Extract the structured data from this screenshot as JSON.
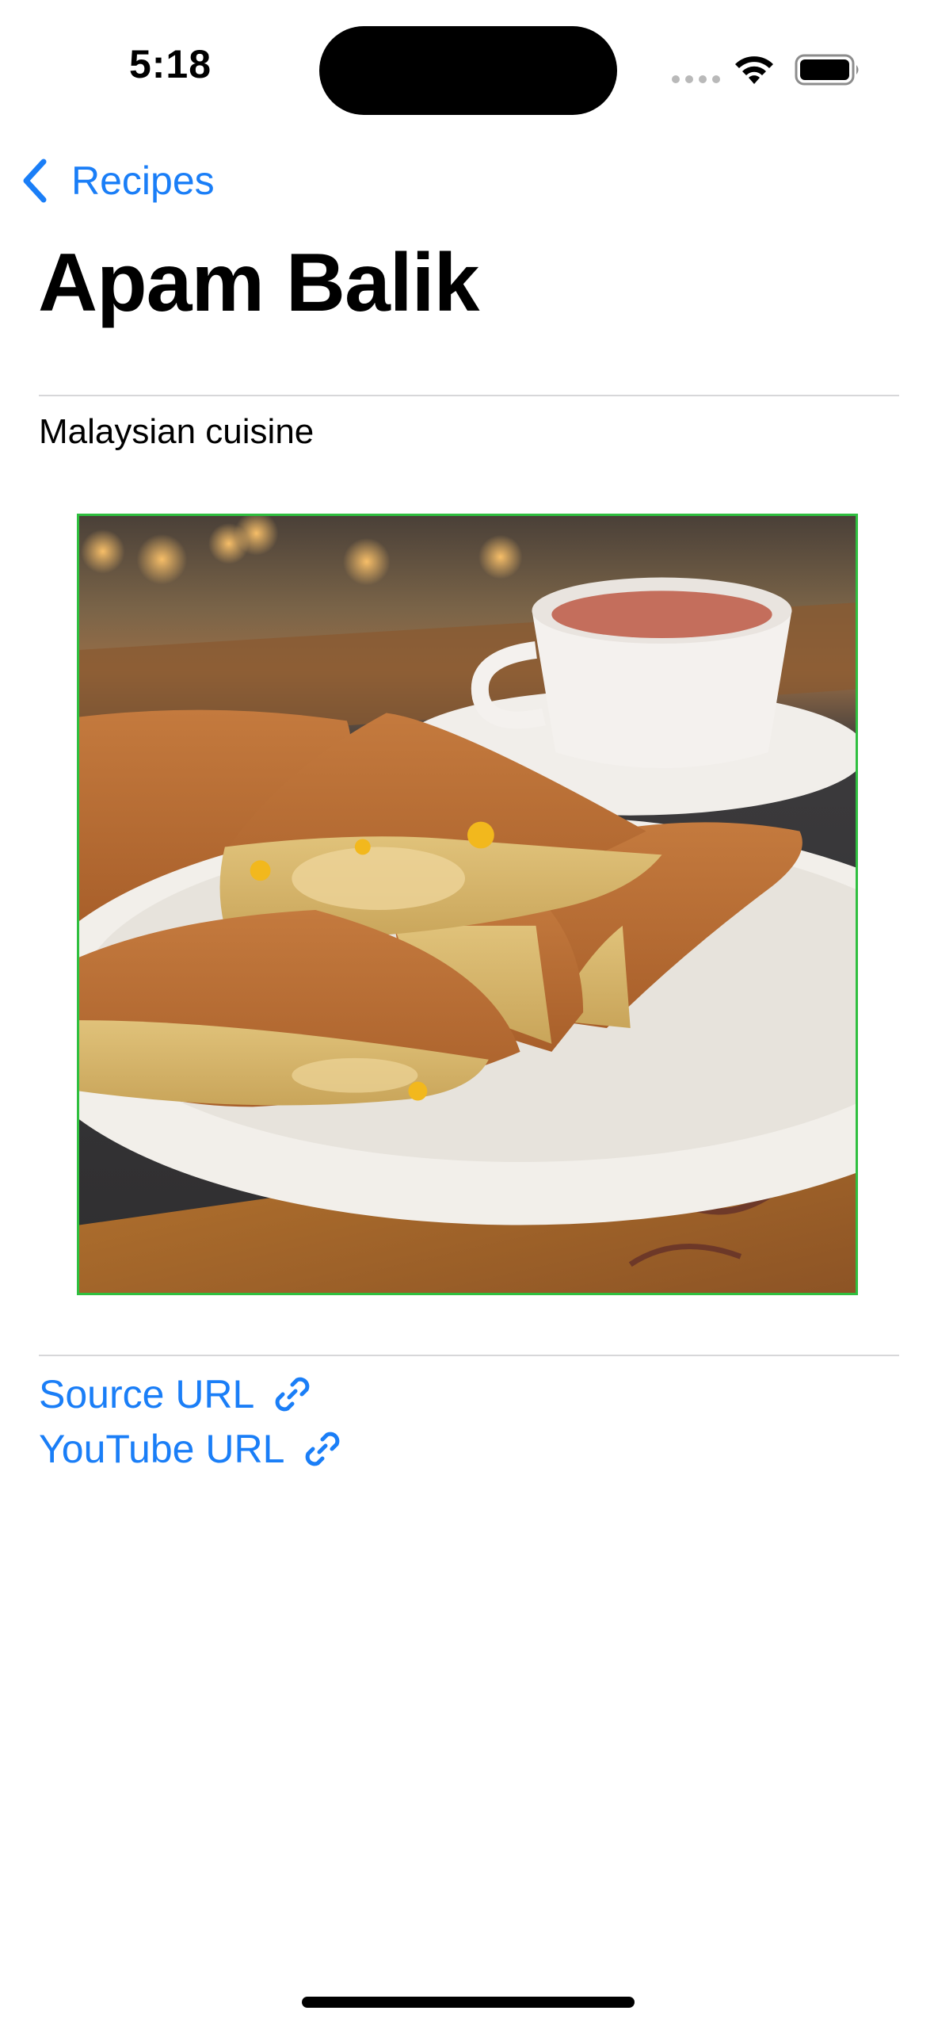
{
  "status_bar": {
    "time": "5:18"
  },
  "nav": {
    "back_label": "Recipes",
    "back_icon": "chevron-left-icon"
  },
  "recipe": {
    "title": "Apam Balik",
    "cuisine": "Malaysian cuisine",
    "image_description": "Apam Balik pancake halves on a white plate with a tea cup",
    "links": [
      {
        "label": "Source URL",
        "icon": "link-icon"
      },
      {
        "label": "YouTube URL",
        "icon": "link-icon"
      }
    ]
  },
  "colors": {
    "accent": "#1a7ef7",
    "image_border": "#2fbf3f",
    "divider": "#d7d7d9"
  }
}
